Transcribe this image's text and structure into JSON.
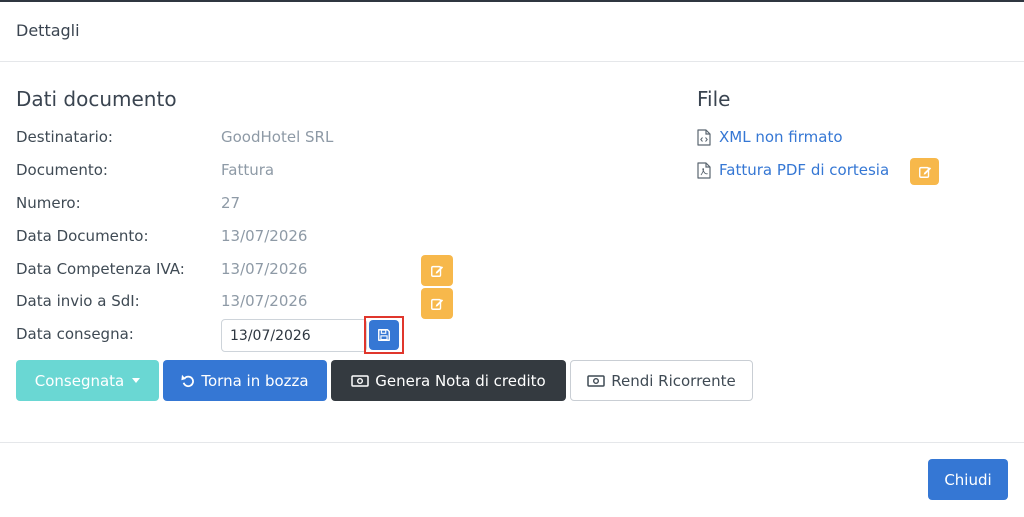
{
  "header": {
    "title": "Dettagli"
  },
  "document_section": {
    "title": "Dati documento",
    "fields": [
      {
        "label": "Destinatario:",
        "value": "GoodHotel SRL"
      },
      {
        "label": "Documento:",
        "value": "Fattura"
      },
      {
        "label": "Numero:",
        "value": "27"
      },
      {
        "label": "Data Documento:",
        "value": "13/07/2026"
      },
      {
        "label": "Data Competenza IVA:",
        "value": "13/07/2026"
      },
      {
        "label": "Data invio a SdI:",
        "value": "13/07/2026"
      }
    ],
    "delivery": {
      "label": "Data consegna:",
      "value": "13/07/2026"
    }
  },
  "actions": {
    "status_dropdown": "Consegnata",
    "back_to_draft": "Torna in bozza",
    "credit_note": "Genera Nota di credito",
    "make_recurring": "Rendi Ricorrente"
  },
  "file_section": {
    "title": "File",
    "links": [
      {
        "label": "XML non firmato",
        "icon": "file-code-icon"
      },
      {
        "label": "Fattura PDF di cortesia",
        "icon": "file-pdf-icon"
      }
    ]
  },
  "footer": {
    "close_label": "Chiudi"
  },
  "colors": {
    "primary": "#3577d4",
    "warning": "#f7b84b",
    "info": "#6ad7d3",
    "dark": "#343a40",
    "highlight": "#e0362c"
  },
  "icons": {
    "edit": "edit-icon",
    "save": "save-icon",
    "undo": "undo-icon",
    "money": "money-bill-icon",
    "caret": "caret-down-icon"
  }
}
